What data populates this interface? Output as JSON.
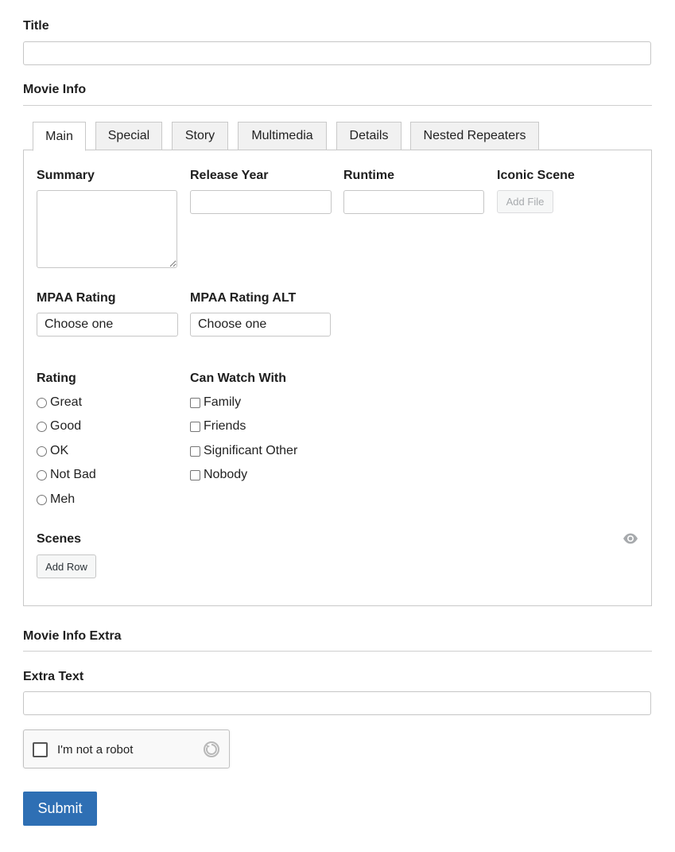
{
  "title_field": {
    "label": "Title",
    "value": ""
  },
  "movie_info": {
    "heading": "Movie Info",
    "tabs": [
      {
        "label": "Main",
        "active": true
      },
      {
        "label": "Special",
        "active": false
      },
      {
        "label": "Story",
        "active": false
      },
      {
        "label": "Multimedia",
        "active": false
      },
      {
        "label": "Details",
        "active": false
      },
      {
        "label": "Nested Repeaters",
        "active": false
      }
    ],
    "main": {
      "summary": {
        "label": "Summary",
        "value": ""
      },
      "release_year": {
        "label": "Release Year",
        "value": ""
      },
      "runtime": {
        "label": "Runtime",
        "value": ""
      },
      "iconic_scene": {
        "label": "Iconic Scene",
        "button": "Add File"
      },
      "mpaa_rating": {
        "label": "MPAA Rating",
        "selected": "Choose one"
      },
      "mpaa_rating_alt": {
        "label": "MPAA Rating ALT",
        "selected": "Choose one"
      },
      "rating": {
        "label": "Rating",
        "options": [
          "Great",
          "Good",
          "OK",
          "Not Bad",
          "Meh"
        ]
      },
      "can_watch_with": {
        "label": "Can Watch With",
        "options": [
          "Family",
          "Friends",
          "Significant Other",
          "Nobody"
        ]
      },
      "scenes": {
        "label": "Scenes",
        "button": "Add Row",
        "toggle_icon": "eye-icon"
      }
    }
  },
  "movie_info_extra": {
    "heading": "Movie Info Extra",
    "extra_text": {
      "label": "Extra Text",
      "value": ""
    }
  },
  "captcha": {
    "label": "I'm not a robot",
    "icon": "recaptcha-icon"
  },
  "submit": {
    "label": "Submit"
  },
  "colors": {
    "primary": "#2e6fb4",
    "border": "#c6c6c6",
    "divider": "#cfcfcf"
  }
}
